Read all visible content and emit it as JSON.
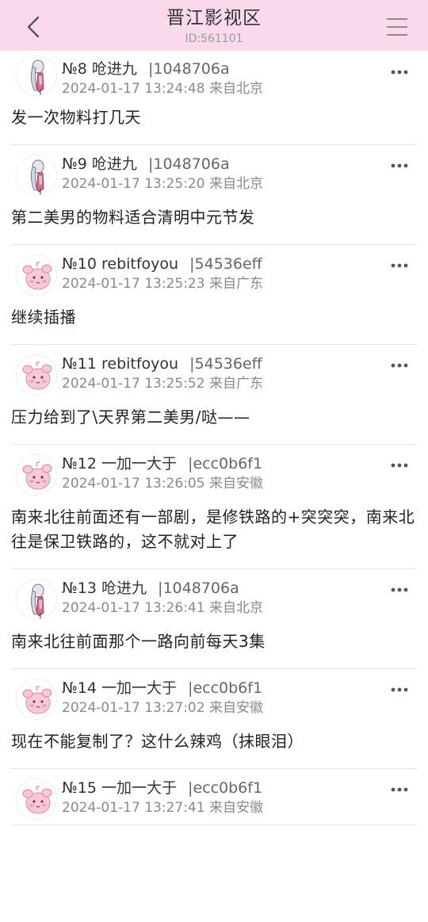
{
  "header": {
    "title": "晋江影视区",
    "subtitle": "ID:561101"
  },
  "posts": [
    {
      "floor": "№8",
      "username": "呛进九",
      "uid": "|1048706a",
      "time": "2024-01-17 13:24:48",
      "location": "来自北京",
      "content": "发一次物料打几天",
      "avatar": "character-avatar"
    },
    {
      "floor": "№9",
      "username": "呛进九",
      "uid": "|1048706a",
      "time": "2024-01-17 13:25:20",
      "location": "来自北京",
      "content": "第二美男的物料适合清明中元节发",
      "avatar": "character-avatar"
    },
    {
      "floor": "№10",
      "username": "rebitfoyou",
      "uid": "|54536eff",
      "time": "2024-01-17 13:25:23",
      "location": "来自广东",
      "content": "继续插播",
      "avatar": "pink-creature-avatar"
    },
    {
      "floor": "№11",
      "username": "rebitfoyou",
      "uid": "|54536eff",
      "time": "2024-01-17 13:25:52",
      "location": "来自广东",
      "content": "压力给到了\\天界第二美男/哒——",
      "avatar": "pink-creature-avatar"
    },
    {
      "floor": "№12",
      "username": "一加一大于",
      "uid": "|ecc0b6f1",
      "time": "2024-01-17 13:26:05",
      "location": "来自安徽",
      "content": "南来北往前面还有一部剧，是修铁路的+突突突，南来北往是保卫铁路的，这不就对上了",
      "avatar": "pink-creature-avatar"
    },
    {
      "floor": "№13",
      "username": "呛进九",
      "uid": "|1048706a",
      "time": "2024-01-17 13:26:41",
      "location": "来自北京",
      "content": "南来北往前面那个一路向前每天3集",
      "avatar": "character-avatar"
    },
    {
      "floor": "№14",
      "username": "一加一大于",
      "uid": "|ecc0b6f1",
      "time": "2024-01-17 13:27:02",
      "location": "来自安徽",
      "content": "现在不能复制了？这什么辣鸡（抹眼泪）",
      "avatar": "pink-creature-avatar"
    },
    {
      "floor": "№15",
      "username": "一加一大于",
      "uid": "|ecc0b6f1",
      "time": "2024-01-17 13:27:41",
      "location": "来自安徽",
      "content": "",
      "avatar": "pink-creature-avatar"
    }
  ],
  "colors": {
    "header_bg": "#fbd9ec",
    "divider": "#e6e6e6",
    "meta_text": "#8a8a8a"
  }
}
